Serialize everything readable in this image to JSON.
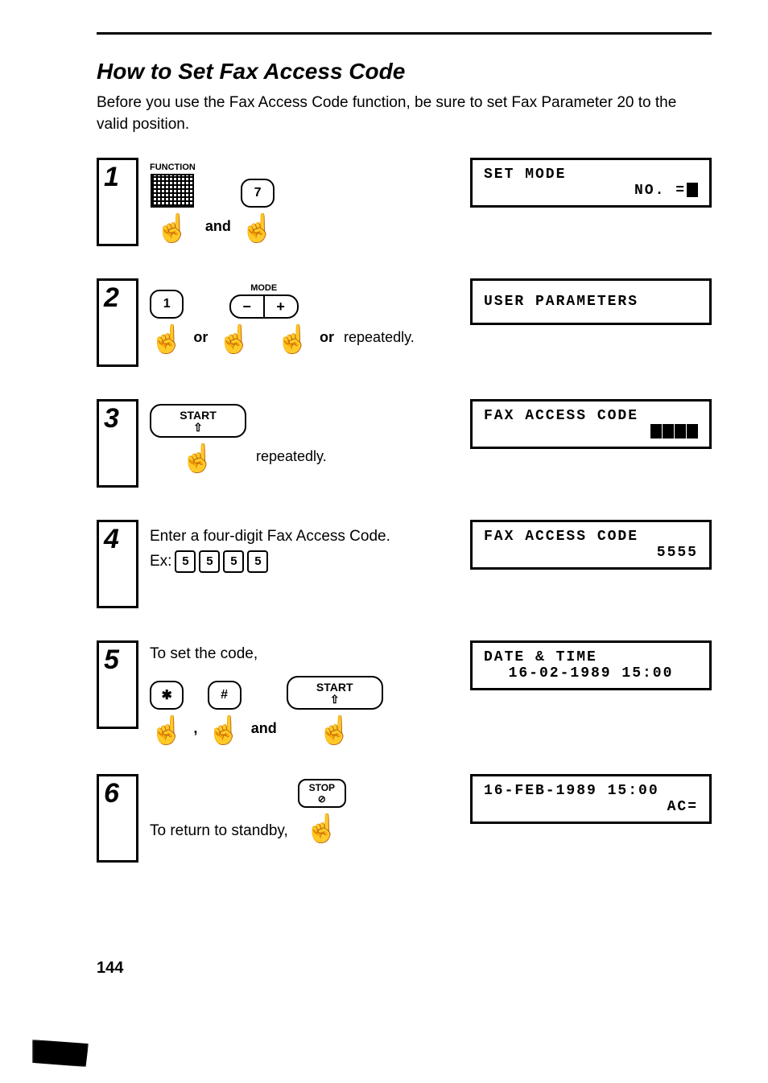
{
  "title": "How to Set Fax Access Code",
  "intro": "Before you use the Fax Access Code function, be sure to set Fax Parameter 20 to the valid position.",
  "page_number": "144",
  "steps": {
    "1": {
      "label_function": "FUNCTION",
      "key7": "7",
      "word_and": "and",
      "display_l1": "SET  MODE",
      "display_l2": "NO. ="
    },
    "2": {
      "key1": "1",
      "label_mode": "MODE",
      "minus": "−",
      "plus": "+",
      "word_or1": "or",
      "word_or2": "or",
      "word_rep": "repeatedly.",
      "display_l1": "USER  PARAMETERS"
    },
    "3": {
      "key_start": "START",
      "word_rep": "repeatedly.",
      "display_l1": "FAX  ACCESS  CODE"
    },
    "4": {
      "text": "Enter a four-digit Fax Access Code.",
      "ex_prefix": "Ex:",
      "ex_digits": [
        "5",
        "5",
        "5",
        "5"
      ],
      "display_l1": "FAX  ACCESS  CODE",
      "display_l2": "5555"
    },
    "5": {
      "text": "To set the code,",
      "key_star": "✱",
      "key_hash": "#",
      "key_start": "START",
      "word_comma": ",",
      "word_and": "and",
      "display_l1": "DATE  &  TIME",
      "display_l2": "16-02-1989  15:00"
    },
    "6": {
      "text": "To return to standby,",
      "key_stop": "STOP",
      "display_l1": "16-FEB-1989  15:00",
      "display_l2": "AC="
    }
  }
}
